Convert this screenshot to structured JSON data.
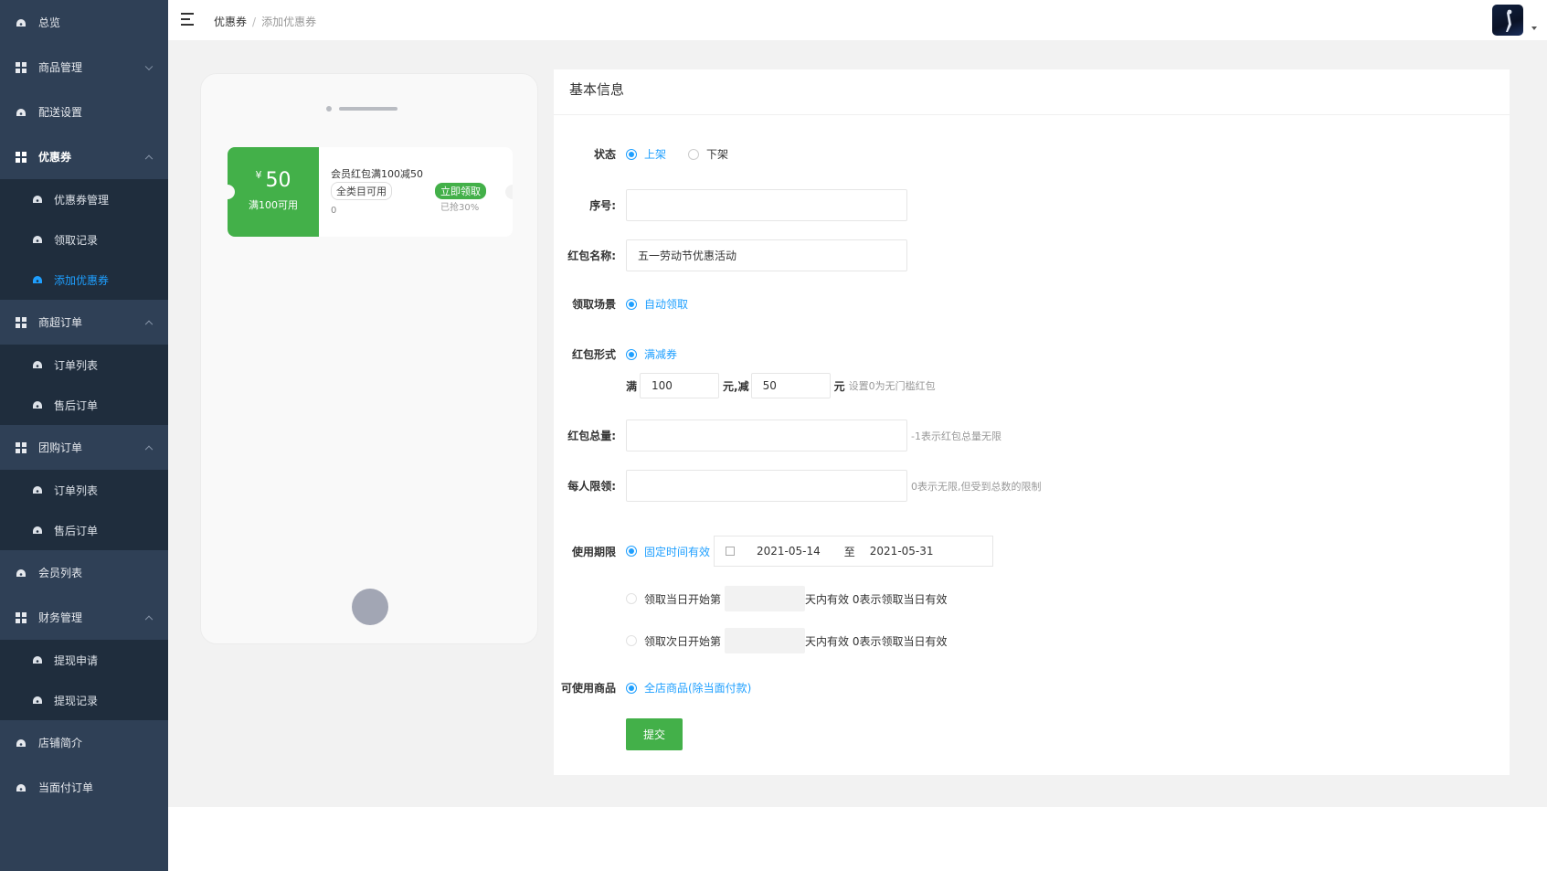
{
  "sidebar": {
    "items": [
      {
        "label": "总览"
      },
      {
        "label": "商品管理"
      },
      {
        "label": "配送设置"
      },
      {
        "label": "优惠券",
        "children": [
          "优惠券管理",
          "领取记录",
          "添加优惠券"
        ]
      },
      {
        "label": "商超订单",
        "children": [
          "订单列表",
          "售后订单"
        ]
      },
      {
        "label": "团购订单",
        "children": [
          "订单列表",
          "售后订单"
        ]
      },
      {
        "label": "会员列表"
      },
      {
        "label": "财务管理",
        "children": [
          "提现申请",
          "提现记录"
        ]
      },
      {
        "label": "店铺简介"
      },
      {
        "label": "当面付订单"
      }
    ]
  },
  "breadcrumb": {
    "parent": "优惠券",
    "current": "添加优惠券"
  },
  "preview": {
    "currency": "¥",
    "amount": "50",
    "condition": "满100可用",
    "title": "会员红包满100减50",
    "tag": "全类目可用",
    "count": "0",
    "get_button": "立即领取",
    "grabbed": "已抢30%"
  },
  "form": {
    "section_title": "基本信息",
    "status": {
      "label": "状态",
      "options": [
        "上架",
        "下架"
      ],
      "selected": "上架"
    },
    "order": {
      "label": "序号:",
      "value": ""
    },
    "name": {
      "label": "红包名称:",
      "value": "五一劳动节优惠活动"
    },
    "scene": {
      "label": "领取场景",
      "option": "自动领取"
    },
    "form_type": {
      "label": "红包形式",
      "option": "满减券"
    },
    "threshold": {
      "prefix": "满",
      "full": "100",
      "mid": "元,减",
      "minus": "50",
      "suffix": "元",
      "hint": "设置0为无门槛红包"
    },
    "total": {
      "label": "红包总量:",
      "value": "",
      "hint": "-1表示红包总量无限"
    },
    "per_user": {
      "label": "每人限领:",
      "value": "",
      "hint": "0表示无限,但受到总数的限制"
    },
    "period": {
      "label": "使用期限",
      "fixed": "固定时间有效",
      "start": "2021-05-14",
      "to": "至",
      "end": "2021-05-31",
      "today_prefix": "领取当日开始第",
      "today_suffix": "天内有效 0表示领取当日有效",
      "next_prefix": "领取次日开始第",
      "next_suffix": "天内有效 0表示领取当日有效"
    },
    "goods": {
      "label": "可使用商品",
      "option": "全店商品(除当面付款)"
    },
    "submit": "提交"
  },
  "colors": {
    "sidebar": "#2f4056",
    "submenu": "#1f2d3d",
    "accent": "#1e9fff",
    "green": "#43b049"
  }
}
